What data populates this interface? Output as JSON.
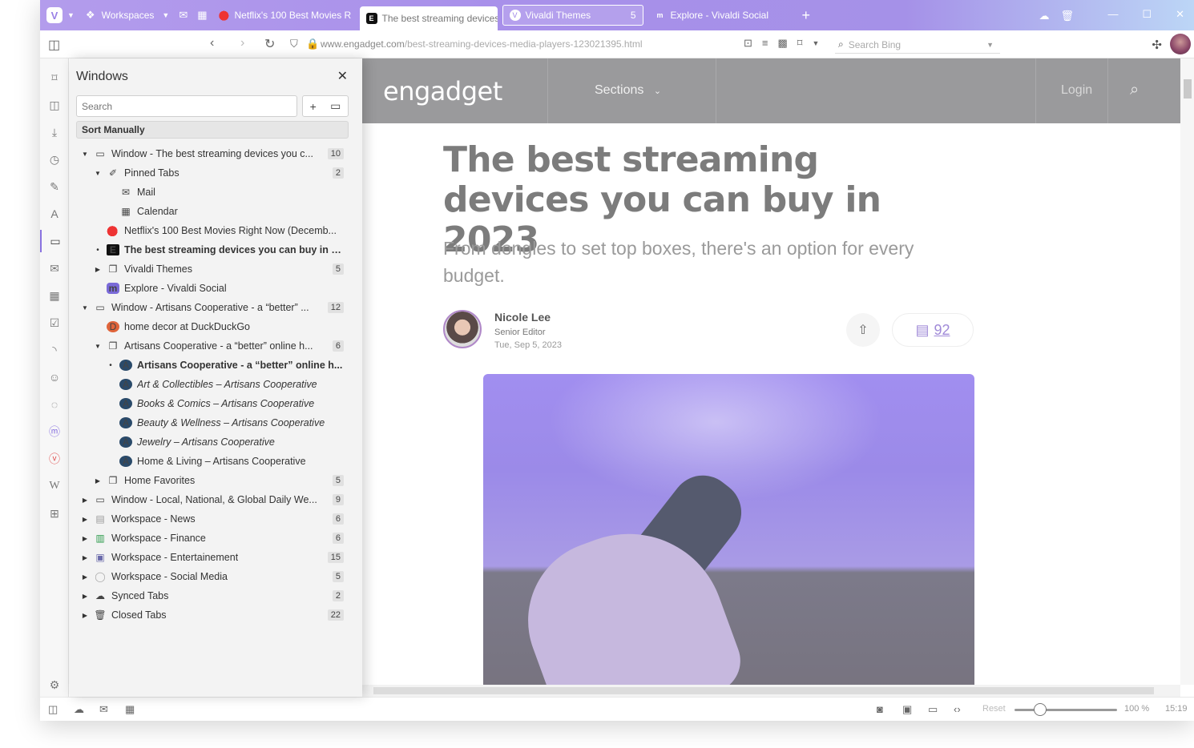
{
  "tabbar": {
    "workspaces_label": "Workspaces",
    "tabs": [
      {
        "title": "Netflix's 100 Best Movies R",
        "state": "normal"
      },
      {
        "title": "The best streaming devices",
        "state": "active"
      },
      {
        "title": "Vivaldi Themes",
        "count": "5",
        "state": "stack"
      },
      {
        "title": "Explore - Vivaldi Social",
        "state": "normal"
      }
    ],
    "new_tab": "+"
  },
  "addressbar": {
    "url_host": "www.engadget.com",
    "url_path": "/best-streaming-devices-media-players-123021395.html",
    "search_placeholder": "Search Bing"
  },
  "panel": {
    "title": "Windows",
    "search_placeholder": "Search",
    "sort_label": "Sort Manually",
    "rows": [
      {
        "label": "Window - The best streaming devices you c...",
        "count": "10"
      },
      {
        "label": "Pinned Tabs",
        "count": "2"
      },
      {
        "label": "Mail"
      },
      {
        "label": "Calendar"
      },
      {
        "label": "Netflix's 100 Best Movies Right Now (Decemb..."
      },
      {
        "label": "The best streaming devices you can buy in 2..."
      },
      {
        "label": "Vivaldi Themes",
        "count": "5"
      },
      {
        "label": "Explore - Vivaldi Social"
      },
      {
        "label": "Window - Artisans Cooperative - a “better” ...",
        "count": "12"
      },
      {
        "label": "home decor at DuckDuckGo"
      },
      {
        "label": "Artisans Cooperative - a “better” online h...",
        "count": "6"
      },
      {
        "label": "Artisans Cooperative - a “better” online h..."
      },
      {
        "label": "Art & Collectibles – Artisans Cooperative"
      },
      {
        "label": "Books & Comics – Artisans Cooperative"
      },
      {
        "label": "Beauty & Wellness – Artisans Cooperative"
      },
      {
        "label": "Jewelry – Artisans Cooperative"
      },
      {
        "label": "Home & Living – Artisans Cooperative"
      },
      {
        "label": "Home Favorites",
        "count": "5"
      },
      {
        "label": "Window - Local, National, & Global Daily We...",
        "count": "9"
      },
      {
        "label": "Workspace - News",
        "count": "6"
      },
      {
        "label": "Workspace - Finance",
        "count": "6"
      },
      {
        "label": "Workspace - Entertainement",
        "count": "15"
      },
      {
        "label": "Workspace - Social Media",
        "count": "5"
      },
      {
        "label": "Synced Tabs",
        "count": "2"
      },
      {
        "label": "Closed Tabs",
        "count": "22"
      }
    ]
  },
  "page": {
    "logo": "engadget",
    "sections": "Sections",
    "login": "Login",
    "headline": "The best streaming devices you can buy in 2023",
    "subhead": "From dongles to set top boxes, there's an option for every budget.",
    "author_name": "Nicole Lee",
    "author_role": "Senior Editor",
    "author_date": "Tue, Sep 5, 2023",
    "comments_count": "92"
  },
  "statusbar": {
    "reset": "Reset",
    "zoom": "100 %",
    "zoom_level": 0.25,
    "clock": "15:19"
  },
  "colors": {
    "accent": "#8a73e0",
    "tabbar": "#a591e8"
  }
}
